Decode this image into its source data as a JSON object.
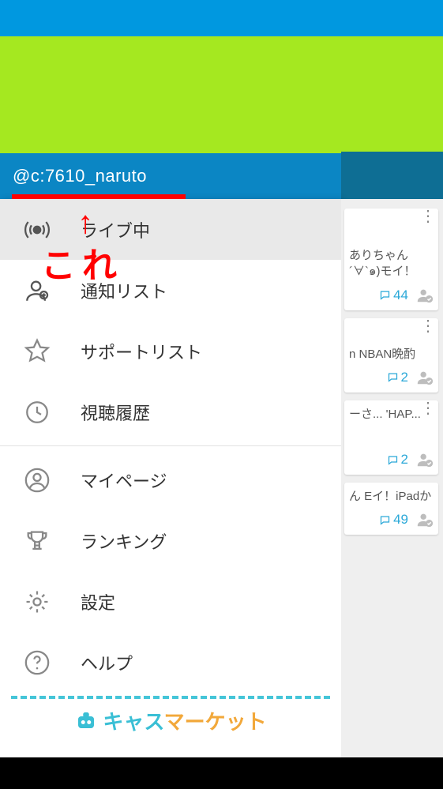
{
  "user": {
    "handle": "@c:7610_naruto"
  },
  "annotation": {
    "label": "これ"
  },
  "menu": {
    "items": [
      {
        "key": "live",
        "label": "ライブ中",
        "icon": "broadcast-icon",
        "active": true
      },
      {
        "key": "notify",
        "label": "通知リスト",
        "icon": "user-plus-icon",
        "active": false
      },
      {
        "key": "support",
        "label": "サポートリスト",
        "icon": "star-icon",
        "active": false
      },
      {
        "key": "history",
        "label": "視聴履歴",
        "icon": "clock-icon",
        "active": false
      }
    ],
    "items2": [
      {
        "key": "mypage",
        "label": "マイページ",
        "icon": "profile-icon"
      },
      {
        "key": "ranking",
        "label": "ランキング",
        "icon": "trophy-icon"
      },
      {
        "key": "settings",
        "label": "設定",
        "icon": "gear-icon"
      },
      {
        "key": "help",
        "label": "ヘルプ",
        "icon": "help-icon"
      }
    ]
  },
  "market": {
    "brand_part1": "キャス",
    "brand_part2": "マーケット"
  },
  "cards": [
    {
      "text": "ありちゃん\n´∀`๑)モイ！",
      "comments": "44"
    },
    {
      "text": "n\nNBAN晩酌",
      "comments": "2"
    },
    {
      "text": "ーさ...\n'HAP...",
      "comments": "2"
    },
    {
      "text": "ん\nEイ！iPadか",
      "comments": "49"
    }
  ],
  "colors": {
    "accent": "#2aa8d8",
    "annotation": "#ff0000"
  }
}
